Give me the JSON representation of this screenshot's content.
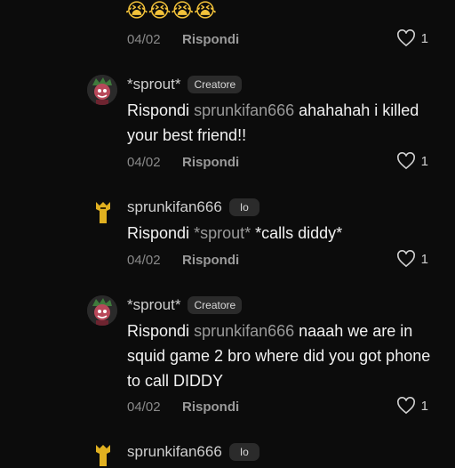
{
  "top": {
    "emojis": "😭😭😭😭",
    "date": "04/02",
    "reply": "Rispondi",
    "likes": "1"
  },
  "comments": [
    {
      "user": "*sprout*",
      "badge": "Creatore",
      "lead": "Rispondi",
      "mention": "sprunkifan666",
      "text": " ahahahah i killed your best friend!!",
      "date": "04/02",
      "reply": "Rispondi",
      "likes": "1"
    },
    {
      "user": "sprunkifan666",
      "badge": "Io",
      "lead": "Rispondi",
      "mention": "*sprout*",
      "text": " *calls diddy*",
      "date": "04/02",
      "reply": "Rispondi",
      "likes": "1"
    },
    {
      "user": "*sprout*",
      "badge": "Creatore",
      "lead": "Rispondi",
      "mention": "sprunkifan666",
      "text": "  naaah we are in squid game 2 bro where did you got phone to call DIDDY",
      "date": "04/02",
      "reply": "Rispondi",
      "likes": "1"
    },
    {
      "user": "sprunkifan666",
      "badge": "Io"
    }
  ],
  "icons": {
    "heart": "heart-outline-icon",
    "avatar_sprout": "sprout-avatar",
    "avatar_sprunki": "sprunki-avatar"
  }
}
